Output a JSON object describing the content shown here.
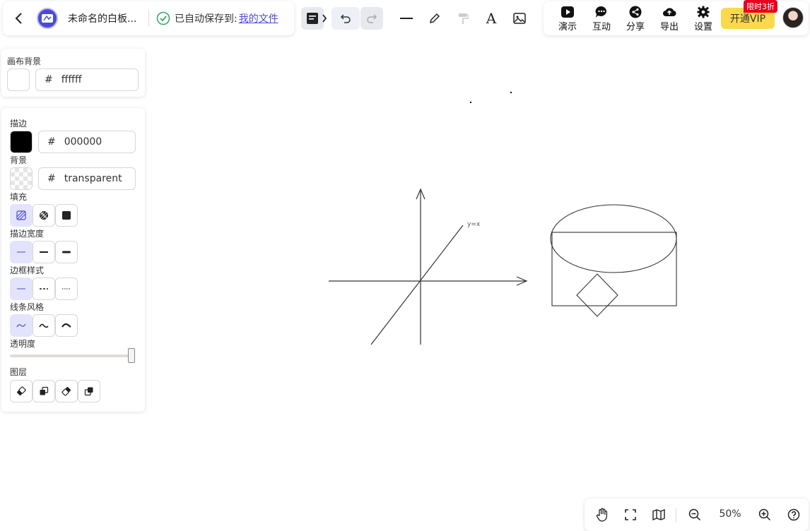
{
  "header": {
    "doc_title": "未命名的白板...",
    "save_status": "已自动保存到:",
    "save_location": "我的文件"
  },
  "actions": {
    "present": "演示",
    "interact": "互动",
    "share": "分享",
    "export": "导出",
    "settings": "设置",
    "vip": "开通VIP",
    "vip_badge": "限时3折"
  },
  "canvas_bg_panel": {
    "label": "画布背景",
    "color": "ffffff"
  },
  "props": {
    "stroke_label": "描边",
    "stroke_color": "000000",
    "background_label": "背景",
    "background_value": "transparent",
    "fill_label": "填充",
    "stroke_width_label": "描边宽度",
    "border_style_label": "边框样式",
    "line_style_label": "线条风格",
    "opacity_label": "透明度",
    "opacity_value": 1,
    "layer_label": "图层"
  },
  "drawing": {
    "axis_label": "y=x"
  },
  "zoom": {
    "level": "50%"
  },
  "colors": {
    "accent": "#4b4bd1",
    "selected_option": "#e3e3fc",
    "vip": "#fbd94c",
    "badge": "#e4001f"
  }
}
